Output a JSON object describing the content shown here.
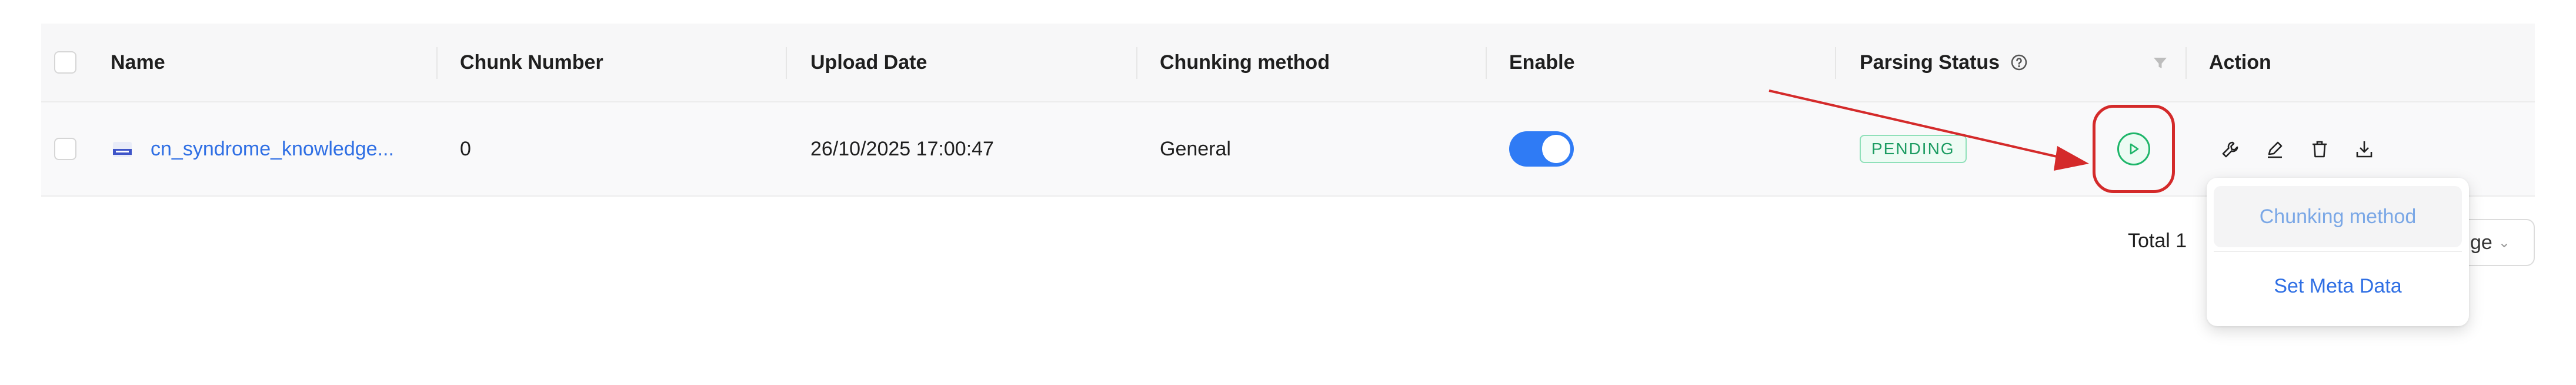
{
  "table": {
    "columns": {
      "name": "Name",
      "chunk_number": "Chunk Number",
      "upload_date": "Upload Date",
      "chunking_method": "Chunking method",
      "enable": "Enable",
      "parsing_status": "Parsing Status",
      "action": "Action"
    },
    "rows": [
      {
        "name": "cn_syndrome_knowledge...",
        "chunk_number": "0",
        "upload_date": "26/10/2025 17:00:47",
        "chunking_method": "General",
        "enabled": true,
        "parsing_status": "PENDING"
      }
    ]
  },
  "footer": {
    "total_label": "Total 1",
    "page_size_partial": "ge"
  },
  "dropdown": {
    "items": [
      "Chunking method",
      "Set Meta Data"
    ]
  },
  "icons": {
    "parsing_help": "help-circle-icon",
    "filter": "filter-icon",
    "run": "play-icon",
    "actions": [
      "wrench-icon",
      "edit-icon",
      "trash-icon",
      "download-icon"
    ]
  },
  "colors": {
    "link": "#2f6fe4",
    "toggle_on": "#2f7bf5",
    "pending_text": "#1c9c62",
    "annotation": "#d42a2a"
  }
}
